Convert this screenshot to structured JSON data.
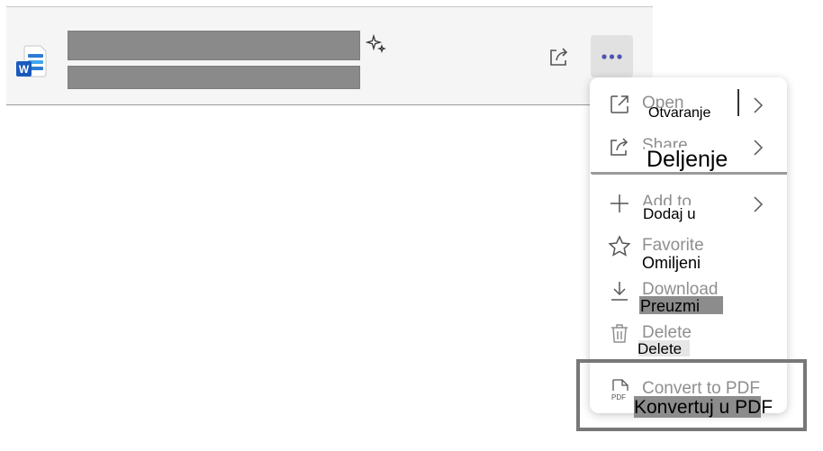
{
  "file": {
    "title_redacted": true,
    "subtitle_redacted": true,
    "icon": "word-doc-icon"
  },
  "toolbar": {
    "share_icon": "share-icon",
    "more_icon": "more-icon",
    "sparkle_icon": "sparkle-icon"
  },
  "menu": {
    "items": [
      {
        "icon": "open-external-icon",
        "original": "Open",
        "label": "Otvaranje",
        "submenu": true
      },
      {
        "icon": "share-icon",
        "original": "Share",
        "label": "Deljenje",
        "submenu": true
      },
      {
        "icon": "plus-icon",
        "original": "Add to",
        "label": "Dodaj u",
        "submenu": true
      },
      {
        "icon": "star-icon",
        "original": "Favorite",
        "label": "Omiljeni",
        "submenu": false
      },
      {
        "icon": "download-icon",
        "original": "Download",
        "label": "Preuzmi",
        "submenu": false
      },
      {
        "icon": "trash-icon",
        "original": "Delete",
        "label": "Delete",
        "submenu": false
      },
      {
        "icon": "pdf-icon",
        "original": "Convert to PDF",
        "label": "Konvertuj u PDF",
        "submenu": false
      }
    ]
  },
  "colors": {
    "accent": "#4f52b2",
    "redaction": "#8a8a8a",
    "highlight_border": "#777777"
  }
}
